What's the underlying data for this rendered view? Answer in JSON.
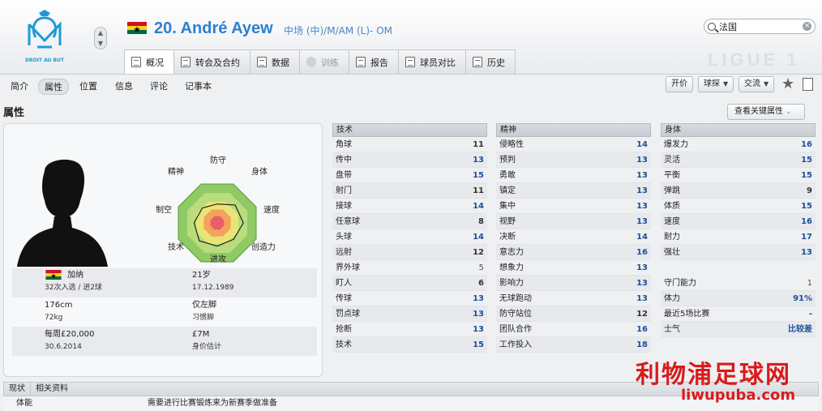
{
  "header": {
    "club_logo_text": "DROIT AU BUT",
    "player_number_name": "20. André Ayew",
    "positions": "中场 (中)/M/AM (L)- OM",
    "search_value": "法国",
    "league_logo_text": "LIGUE 1",
    "tabs": [
      {
        "label": "概况",
        "icon": "overview-icon"
      },
      {
        "label": "转会及合约",
        "icon": "contract-icon"
      },
      {
        "label": "数据",
        "icon": "stats-icon"
      },
      {
        "label": "训练",
        "icon": "training-icon"
      },
      {
        "label": "报告",
        "icon": "report-icon"
      },
      {
        "label": "球员对比",
        "icon": "compare-icon"
      },
      {
        "label": "历史",
        "icon": "history-icon"
      }
    ]
  },
  "subnav": {
    "items": [
      "简介",
      "属性",
      "位置",
      "信息",
      "评论",
      "记事本"
    ],
    "active": "属性",
    "buttons": {
      "bid": "开价",
      "scout": "球探",
      "interact": "交流"
    }
  },
  "section": {
    "title": "属性",
    "key_attr_button": "查看关键属性"
  },
  "radar": {
    "labels": [
      "防守",
      "身体",
      "速度",
      "创造力",
      "进攻",
      "技术",
      "制空",
      "精神"
    ],
    "values": [
      0.45,
      0.6,
      0.62,
      0.55,
      0.55,
      0.6,
      0.55,
      0.5
    ]
  },
  "profile": {
    "nation": "加纳",
    "caps": "32次入选 / 进2球",
    "age": "21岁",
    "dob": "17.12.1989",
    "height": "176cm",
    "weight": "72kg",
    "foot": "仅左脚",
    "foot_label": "习惯脚",
    "wage": "每周£20,000",
    "contract_end": "30.6.2014",
    "value": "£7M",
    "value_label": "身价估计"
  },
  "technical": {
    "title": "技术",
    "rows": [
      {
        "name": "角球",
        "value": "11"
      },
      {
        "name": "传中",
        "value": "13"
      },
      {
        "name": "盘带",
        "value": "15"
      },
      {
        "name": "射门",
        "value": "11"
      },
      {
        "name": "接球",
        "value": "14"
      },
      {
        "name": "任意球",
        "value": "8"
      },
      {
        "name": "头球",
        "value": "14"
      },
      {
        "name": "远射",
        "value": "12"
      },
      {
        "name": "界外球",
        "value": "5"
      },
      {
        "name": "盯人",
        "value": "6"
      },
      {
        "name": "传球",
        "value": "13"
      },
      {
        "name": "罚点球",
        "value": "13"
      },
      {
        "name": "抢断",
        "value": "13"
      },
      {
        "name": "技术",
        "value": "15"
      }
    ]
  },
  "mental": {
    "title": "精神",
    "rows": [
      {
        "name": "侵略性",
        "value": "14"
      },
      {
        "name": "预判",
        "value": "13"
      },
      {
        "name": "勇敢",
        "value": "13"
      },
      {
        "name": "镇定",
        "value": "13"
      },
      {
        "name": "集中",
        "value": "13"
      },
      {
        "name": "视野",
        "value": "13"
      },
      {
        "name": "决断",
        "value": "14"
      },
      {
        "name": "意志力",
        "value": "16"
      },
      {
        "name": "想象力",
        "value": "13"
      },
      {
        "name": "影响力",
        "value": "13"
      },
      {
        "name": "无球跑动",
        "value": "13"
      },
      {
        "name": "防守站位",
        "value": "12"
      },
      {
        "name": "团队合作",
        "value": "16"
      },
      {
        "name": "工作投入",
        "value": "18"
      }
    ]
  },
  "physical": {
    "title": "身体",
    "rows": [
      {
        "name": "爆发力",
        "value": "16"
      },
      {
        "name": "灵活",
        "value": "15"
      },
      {
        "name": "平衡",
        "value": "15"
      },
      {
        "name": "弹跳",
        "value": "9"
      },
      {
        "name": "体质",
        "value": "15"
      },
      {
        "name": "速度",
        "value": "16"
      },
      {
        "name": "耐力",
        "value": "17"
      },
      {
        "name": "强壮",
        "value": "13"
      }
    ],
    "extra": [
      {
        "name": "守门能力",
        "value": "1"
      },
      {
        "name": "体力",
        "value": "91%"
      },
      {
        "name": "最近5场比赛",
        "value": "-"
      },
      {
        "name": "士气",
        "value": "比较差"
      }
    ]
  },
  "bottom": {
    "tabs": [
      "现状",
      "相关资料"
    ],
    "row_label": "体能",
    "row_value": "需要进行比赛锻炼来为新赛季做准备"
  },
  "watermark": {
    "cn": "利物浦足球网",
    "en": "liwupuba.com"
  },
  "colors": {
    "title_blue": "#2e7fd1",
    "value_blue": "#1d4f9c",
    "watermark_red": "#d91b1b"
  }
}
